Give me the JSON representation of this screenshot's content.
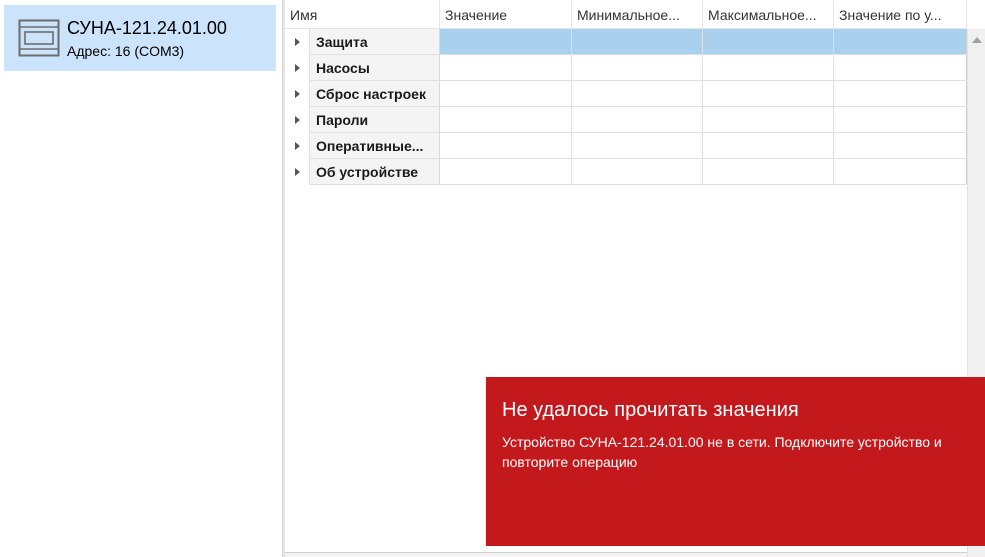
{
  "device": {
    "icon": "device-rack-icon",
    "name": "СУНА-121.24.01.00",
    "address": "Адрес: 16 (COM3)"
  },
  "grid": {
    "columns": [
      "Имя",
      "Значение",
      "Минимальное...",
      "Максимальное...",
      "Значение по у..."
    ],
    "rows": [
      {
        "name": "Защита",
        "selected": true
      },
      {
        "name": "Насосы"
      },
      {
        "name": "Сброс настроек"
      },
      {
        "name": "Пароли"
      },
      {
        "name": "Оперативные..."
      },
      {
        "name": "Об устройстве"
      }
    ]
  },
  "toast": {
    "title": "Не удалось прочитать значения",
    "message": "Устройство СУНА-121.24.01.00  не в сети. Подключите устройство и повторите операцию",
    "color": "#c4191c"
  },
  "colors": {
    "selection": "#cce4fb",
    "row_selected": "#a9d1ee"
  }
}
